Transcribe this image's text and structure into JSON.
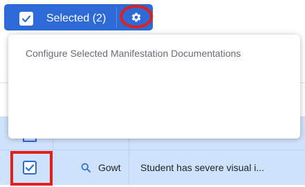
{
  "toolbar": {
    "selected_label": "Selected (2)",
    "accent_color": "#2d6ad6",
    "icons": [
      "check-icon",
      "gear-icon"
    ]
  },
  "popup": {
    "title": "Configure Selected Manifestation Documentations"
  },
  "table": {
    "rows": [
      {
        "checked": true,
        "name": "Gowt",
        "description": "Student has severe visual i...",
        "icon": "search-icon"
      }
    ]
  },
  "annotation_color": "#e0201b"
}
